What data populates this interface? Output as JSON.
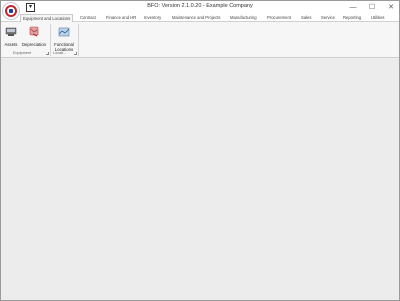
{
  "window": {
    "title": "BFO: Version 2.1.0.20 - Example Company",
    "quick_access": "▾",
    "minimize": "—",
    "maximize": "☐",
    "close": "✕"
  },
  "tabs": [
    {
      "label": "Equipment and Locations",
      "active": true
    },
    {
      "label": "Contract"
    },
    {
      "label": "Finance and HR"
    },
    {
      "label": "Inventory"
    },
    {
      "label": "Maintenance and Projects"
    },
    {
      "label": "Manufacturing"
    },
    {
      "label": "Procurement"
    },
    {
      "label": "Sales"
    },
    {
      "label": "Service"
    },
    {
      "label": "Reporting"
    },
    {
      "label": "Utilities"
    }
  ],
  "ribbon": {
    "equipment_group": {
      "label": "Equipment",
      "assets": "Assets",
      "depreciation": "Depreciation"
    },
    "locations_group": {
      "label": "Locati...",
      "functional_locations_line1": "Functional",
      "functional_locations_line2": "Locations"
    }
  },
  "colors": {
    "accent_red": "#c0262d",
    "accent_blue": "#1e3f8f"
  }
}
